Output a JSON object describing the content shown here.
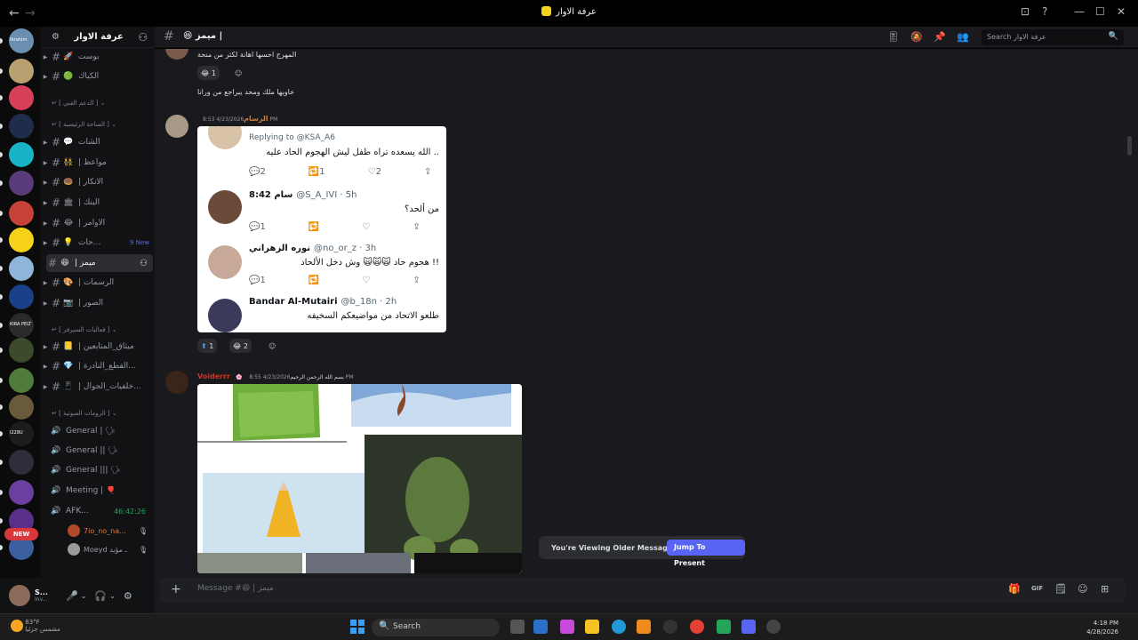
{
  "window": {
    "title": "عرفة الاوار",
    "back": "←",
    "forward": "→",
    "controls": [
      "⊡",
      "?",
      "—",
      "☐",
      "✕"
    ]
  },
  "servers": [
    {
      "color": "#6b8fb0",
      "mini": "Ibrahim"
    },
    {
      "color": "#b8a070"
    },
    {
      "color": "#d8405a"
    },
    {
      "color": "#1f2d4a"
    },
    {
      "color": "#19b3c8"
    },
    {
      "color": "#5a3b7a"
    },
    {
      "color": "#c8423a"
    },
    {
      "color": "#f7d21a"
    },
    {
      "color": "#8fb6d8"
    },
    {
      "color": "#1c3f8a"
    },
    {
      "color": "#2b2b2b",
      "mini": "KIRA PELT"
    },
    {
      "color": "#3d4a2c"
    },
    {
      "color": "#4f7a3a"
    },
    {
      "color": "#6a5a3c"
    },
    {
      "color": "#1d1d1d",
      "mini": "I228U"
    },
    {
      "color": "#2e2e3a"
    },
    {
      "color": "#6b3fa0"
    },
    {
      "color": "#5a2f8a"
    },
    {
      "color": "#3b5fa0"
    }
  ],
  "new_badge": "NEW",
  "server_name": "عرفة الاوار",
  "channels": [
    {
      "type": "text",
      "emoji": "🚀",
      "label": "بوست"
    },
    {
      "type": "text",
      "emoji": "🟢",
      "label": "الكباك"
    },
    {
      "type": "category",
      "label": "[ الدعم الفني ]"
    },
    {
      "type": "category",
      "label": "[ الساحة الرئيسية ]"
    },
    {
      "type": "text",
      "emoji": "💬",
      "label": "الشات"
    },
    {
      "type": "text",
      "emoji": "👯",
      "label": "| مواعظ"
    },
    {
      "type": "text",
      "emoji": "🍩",
      "label": "| الانكار"
    },
    {
      "type": "text",
      "emoji": "🏛",
      "label": "| البنك"
    },
    {
      "type": "text",
      "emoji": "😂",
      "label": "| الاوامر"
    },
    {
      "type": "text",
      "emoji": "💡",
      "label": "حات...",
      "badge": "9 New"
    },
    {
      "type": "text",
      "emoji": "😆",
      "label": "| ميمز",
      "active": true
    },
    {
      "type": "text",
      "emoji": "🎨",
      "label": "| الرسمات"
    },
    {
      "type": "text",
      "emoji": "📷",
      "label": "| الصور"
    },
    {
      "type": "category",
      "label": "[ فعاليات السيرفر ]"
    },
    {
      "type": "text",
      "emoji": "📒",
      "label": "| ميثاق_المتابعين"
    },
    {
      "type": "text",
      "emoji": "💎",
      "label": "| القطع_النادرة..."
    },
    {
      "type": "text",
      "emoji": "📱",
      "label": "| خلفيات_الجوال..."
    },
    {
      "type": "category",
      "label": "[ الرومات الصوتية ]"
    },
    {
      "type": "voice",
      "emoji": "🗣",
      "label": "General |"
    },
    {
      "type": "voice",
      "emoji": "🗣",
      "label": "General ||"
    },
    {
      "type": "voice",
      "emoji": "🗣",
      "label": "General |||"
    },
    {
      "type": "voice",
      "emoji": "🎈",
      "label": "Meeting |"
    },
    {
      "type": "voice",
      "label": "AFK...",
      "extra": "46:42:26"
    }
  ],
  "voice_users": [
    {
      "name": "7io_no_na...",
      "color": "#e07a3a",
      "avatar": "#b04a2a"
    },
    {
      "name": "Moeyd ـ مؤيد",
      "color": "#949ba4",
      "avatar": "#9a9a9a"
    }
  ],
  "user": {
    "name": "S...",
    "status": "Inv..."
  },
  "user_controls": [
    "🎤",
    "⌄",
    "🎧",
    "⌄",
    "⚙"
  ],
  "header": {
    "channel": "ميمز |",
    "channel_emoji": "😆",
    "icons": [
      "🎚",
      "🔕",
      "📌",
      "👥"
    ],
    "search_placeholder": "Search عرفة الاوار",
    "search_icon": "🔍"
  },
  "messages": {
    "m1_text": "المهرج احسها اهانة لكثر من منحة",
    "m1_react_count": "1",
    "m1_react_emoji": "😂",
    "m1_add_react": "☺",
    "m2_text": "خاويها ملك ومحد يبراجع من ورانا",
    "m3_author": "الرسام",
    "m3_time": "4/23/2026 8:53 PM",
    "m3_react1_count": "1",
    "m3_react1_emoji": "⬆",
    "m3_react2_count": "2",
    "m3_react2_emoji": "😂",
    "m4_author": "Voiderrr",
    "m4_tag": "🌸 بسم الله الرحمن الرحيم",
    "m4_time": "4/23/2026 8:55 PM"
  },
  "screenshot": {
    "tweets": [
      {
        "reply": "Replying to @KSA_A6",
        "body": "الله يسعده تراه طفل ليش الهجوم الحاد عليه ..",
        "counts": [
          "2",
          "1",
          "2"
        ]
      },
      {
        "name": "سام 8:42",
        "handle": "@S_A_IVI · 5h",
        "body": "من ألحد؟",
        "counts": [
          "1",
          "",
          ""
        ]
      },
      {
        "name": "نوره الزهراني",
        "handle": "@no_or_z · 3h",
        "body": "هجوم حاد 🙀🙀🙀 وش دخل الألحاد !!",
        "counts": [
          "1",
          "",
          ""
        ]
      },
      {
        "name": "Bandar Al-Mutairi",
        "handle": "@b_18n · 2h",
        "body": "طلعو الاتحاد من مواضيعكم السخيفه"
      }
    ],
    "action_icons": [
      "💬",
      "🔁",
      "♡",
      "⇪"
    ]
  },
  "older_banner": {
    "text": "You're Viewing Older Messages",
    "button": "Jump To Present"
  },
  "composer": {
    "placeholder": "Message #😆 | ميمز",
    "plus": "+",
    "icons": [
      "🎁",
      "GIF",
      "🗒",
      "☺",
      "⊞"
    ]
  },
  "taskbar": {
    "weather": "83°F\nمشمس جزئيا",
    "search": "Search",
    "search_icon": "🔍",
    "time": "4:18 PM",
    "date": "4/28/2026"
  }
}
